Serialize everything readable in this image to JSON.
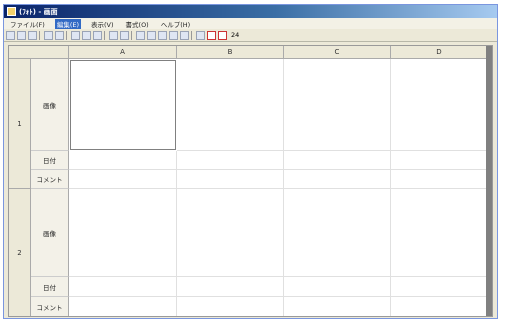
{
  "window": {
    "title": "(ﾌｫﾄ) - 画面"
  },
  "menu": [
    {
      "label": "ファイル(F)",
      "active": false
    },
    {
      "label": "編集(E)",
      "active": true
    },
    {
      "label": "表示(V)",
      "active": false
    },
    {
      "label": "書式(O)",
      "active": false
    },
    {
      "label": "ヘルプ(H)",
      "active": false
    }
  ],
  "toolbar": {
    "zoom_label": "24"
  },
  "sheet": {
    "columns": [
      "A",
      "B",
      "C",
      "D"
    ],
    "rows": [
      {
        "number": "1",
        "photo_label": "画像",
        "date_label": "日付",
        "comment_label": "コメント"
      },
      {
        "number": "2",
        "photo_label": "画像",
        "date_label": "日付",
        "comment_label": "コメント"
      }
    ]
  }
}
